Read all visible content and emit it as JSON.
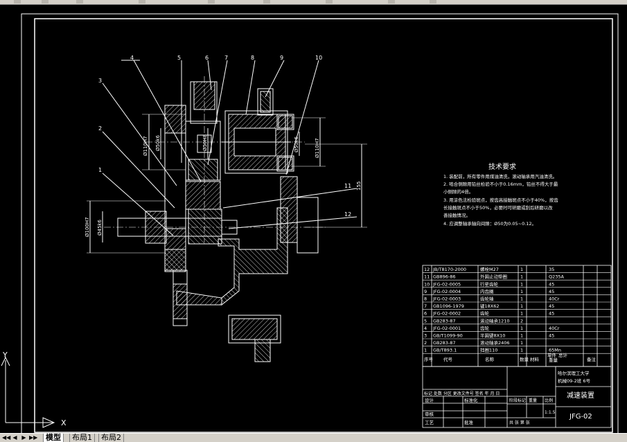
{
  "tabs": [
    {
      "label": "模型"
    },
    {
      "label": "布局1"
    },
    {
      "label": "布局2"
    }
  ],
  "drawing": {
    "part_numbers": [
      "1",
      "2",
      "3",
      "4",
      "5",
      "6",
      "7",
      "8",
      "9",
      "10",
      "11",
      "12"
    ],
    "dims": {
      "d1": "Ø110H7",
      "d2": "Ø50k6",
      "d3": "Ø50H8",
      "d4": "Ø50k6",
      "d5": "Ø110H7",
      "d6": "Ø100H7",
      "d7": "Ø45k6",
      "d8": "155"
    },
    "tech_req": {
      "title": "技术要求",
      "lines": [
        "1. 装配前，所有零件用煤油清洗，滚动轴承用汽油清洗。",
        "2. 啮合侧隙用铅丝检验不小于0.16mm，铅丝不得大于最",
        "   小侧隙的4倍。",
        "3. 用涂色法检验斑点，按齿高接触斑点不小于40%，按齿",
        "   长接触斑点不小于50%，必要时可研磨或刮后研磨以改",
        "   善接触情况。",
        "4. 应调整轴承轴向间隙：Ø50为0.05~0.12。"
      ]
    },
    "bom": [
      {
        "no": "12",
        "code": "JB/T8170-2000",
        "name": "螺栓M27",
        "qty": "1",
        "material": "35"
      },
      {
        "no": "11",
        "code": "GB896-86",
        "name": "外圆止动垫圈",
        "qty": "1",
        "material": "Q235A"
      },
      {
        "no": "10",
        "code": "JFG-02-0005",
        "name": "行星齿轮",
        "qty": "1",
        "material": "45"
      },
      {
        "no": "9",
        "code": "JFG-02-0004",
        "name": "内齿圈",
        "qty": "1",
        "material": "45"
      },
      {
        "no": "8",
        "code": "JFG-02-0003",
        "name": "齿轮轴",
        "qty": "1",
        "material": "40Cr"
      },
      {
        "no": "7",
        "code": "GB1096-1979",
        "name": "键18X62",
        "qty": "1",
        "material": "45"
      },
      {
        "no": "6",
        "code": "JFG-02-0002",
        "name": "齿轮",
        "qty": "1",
        "material": "45"
      },
      {
        "no": "5",
        "code": "GB283-87",
        "name": "滚动轴承1210",
        "qty": "2",
        "material": ""
      },
      {
        "no": "4",
        "code": "JFG-02-0001",
        "name": "齿轮",
        "qty": "1",
        "material": "40Cr"
      },
      {
        "no": "3",
        "code": "GB/T1099-90",
        "name": "半圆键8X10",
        "qty": "1",
        "material": "45"
      },
      {
        "no": "2",
        "code": "GB283-87",
        "name": "滚动轴承2406",
        "qty": "1",
        "material": ""
      },
      {
        "no": "1",
        "code": "GB/T893.1",
        "name": "挡圈110",
        "qty": "1",
        "material": "65Mn"
      }
    ],
    "bom_header": {
      "no": "序号",
      "code": "代号",
      "name": "名称",
      "qty": "数量",
      "material": "材料",
      "unit_weight": "单件",
      "total_weight": "总计",
      "weight": "重量",
      "remark": "备注"
    },
    "title_block": {
      "school": "哈尔滨理工大学",
      "class": "机械09-2班 6号",
      "drawing_name": "减速装置",
      "drawing_no": "JFG-02",
      "scale": "1:1.5",
      "design": "设计",
      "standard": "标准化",
      "review": "审核",
      "process": "工艺",
      "approve": "批准",
      "stage_label": "阶段标记",
      "weight_label": "重量",
      "scale_label": "比例",
      "sheets": "共  张  第  张",
      "rev_row": "标记 处数 分区 更改文件号 签名 年 月 日"
    }
  },
  "ucs": {
    "x_label": "X",
    "y_label": "Y"
  },
  "colors": {
    "bg": "#000000",
    "lines": "#ffffff",
    "ui": "#d4d0c8"
  }
}
